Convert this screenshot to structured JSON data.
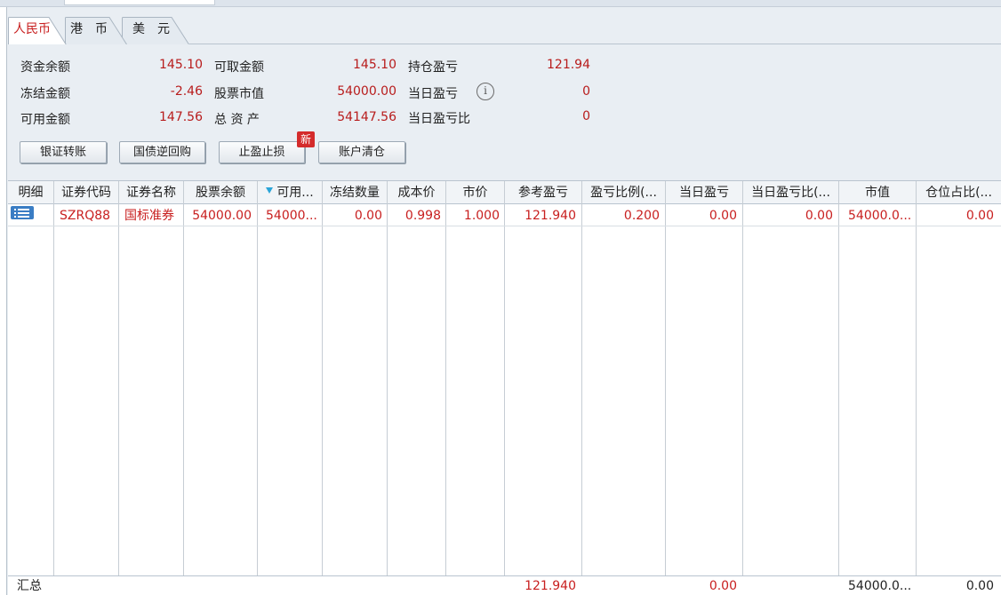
{
  "tabs": [
    {
      "label": "人民币",
      "active": true
    },
    {
      "label": "港　币",
      "active": false
    },
    {
      "label": "美　元",
      "active": false
    }
  ],
  "summary": {
    "fund_balance_label": "资金余额",
    "fund_balance": "145.10",
    "withdrawable_label": "可取金额",
    "withdrawable": "145.10",
    "position_pnl_label": "持仓盈亏",
    "position_pnl": "121.94",
    "frozen_label": "冻结金额",
    "frozen": "-2.46",
    "stock_value_label": "股票市值",
    "stock_value": "54000.00",
    "today_pnl_label": "当日盈亏",
    "today_pnl": "0",
    "available_label": "可用金额",
    "available": "147.56",
    "total_assets_label": "总 资 产",
    "total_assets": "54147.56",
    "today_pnl_ratio_label": "当日盈亏比",
    "today_pnl_ratio": "0"
  },
  "buttons": {
    "bank_transfer": "银证转账",
    "bond_repo": "国债逆回购",
    "take_profit_stop_loss": "止盈止损",
    "new_badge": "新",
    "clear_position": "账户清仓"
  },
  "table": {
    "headers": [
      "明细",
      "证券代码",
      "证券名称",
      "股票余额",
      "可用...",
      "冻结数量",
      "成本价",
      "市价",
      "参考盈亏",
      "盈亏比例(...",
      "当日盈亏",
      "当日盈亏比(...",
      "市值",
      "仓位占比(..."
    ],
    "sorted_column": "可用...",
    "row": {
      "code": "SZRQ88",
      "name": "国标准券",
      "stock_balance": "54000.00",
      "available": "54000...",
      "frozen_qty": "0.00",
      "cost_price": "0.998",
      "market_price": "1.000",
      "ref_pnl": "121.940",
      "pnl_ratio": "0.200",
      "today_pnl": "0.00",
      "today_pnl_ratio": "0.00",
      "market_value": "54000.0...",
      "position_ratio": "0.00"
    },
    "totals": {
      "label": "汇总",
      "ref_pnl": "121.940",
      "today_pnl": "0.00",
      "market_value": "54000.0...",
      "position_ratio": "0.00"
    }
  },
  "colors": {
    "value_red": "#b81c1c",
    "active_tab_red": "#c81f1f",
    "sort_icon": "#2aa5d8",
    "detail_icon": "#3a7dc4",
    "badge_red": "#d42b2b"
  },
  "icons": {
    "info": "info-icon",
    "sort": "sort-desc-icon",
    "detail": "list-detail-icon"
  }
}
